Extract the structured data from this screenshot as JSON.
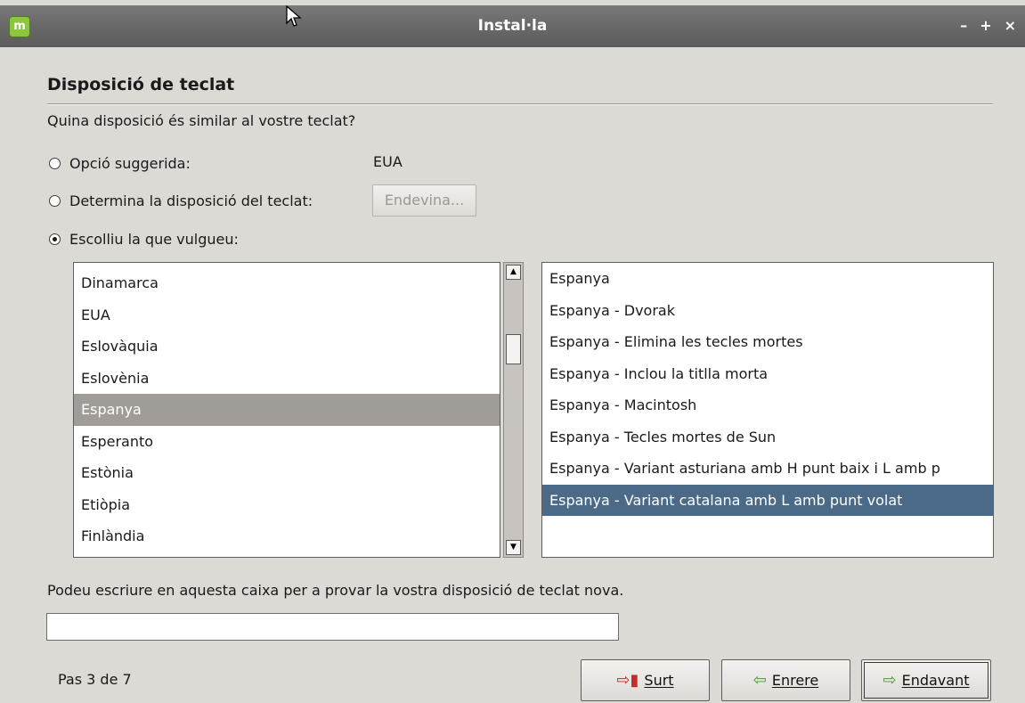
{
  "window": {
    "title": "Instal·la",
    "controls": [
      "–",
      "+",
      "×"
    ]
  },
  "page": {
    "heading": "Disposició de teclat",
    "question": "Quina disposició és similar al vostre teclat?"
  },
  "options": {
    "suggested_label": "Opció suggerida:",
    "suggested_value": "EUA",
    "detect_label": "Determina la disposició del teclat:",
    "detect_button": "Endevina...",
    "choose_label": "Escolliu la que vulgueu:",
    "selected": "choose"
  },
  "countries": {
    "items": [
      "Dinamarca",
      "EUA",
      "Eslovàquia",
      "Eslovènia",
      "Espanya",
      "Esperanto",
      "Estònia",
      "Etiòpia",
      "Finlàndia"
    ],
    "selected": "Espanya"
  },
  "variants": {
    "items": [
      "Espanya",
      "Espanya - Dvorak",
      "Espanya - Elimina les tecles mortes",
      "Espanya - Inclou la titlla morta",
      "Espanya - Macintosh",
      "Espanya - Tecles mortes de Sun",
      "Espanya - Variant asturiana amb H punt baix i L amb p",
      "Espanya - Variant catalana amb L amb punt volat"
    ],
    "selected": "Espanya - Variant catalana amb L amb punt volat"
  },
  "test": {
    "label": "Podeu escriure en aquesta caixa per a provar la vostra disposició de teclat nova.",
    "value": ""
  },
  "footer": {
    "step": "Pas 3 de 7",
    "quit": "Surt",
    "back": "Enrere",
    "next": "Endavant"
  }
}
